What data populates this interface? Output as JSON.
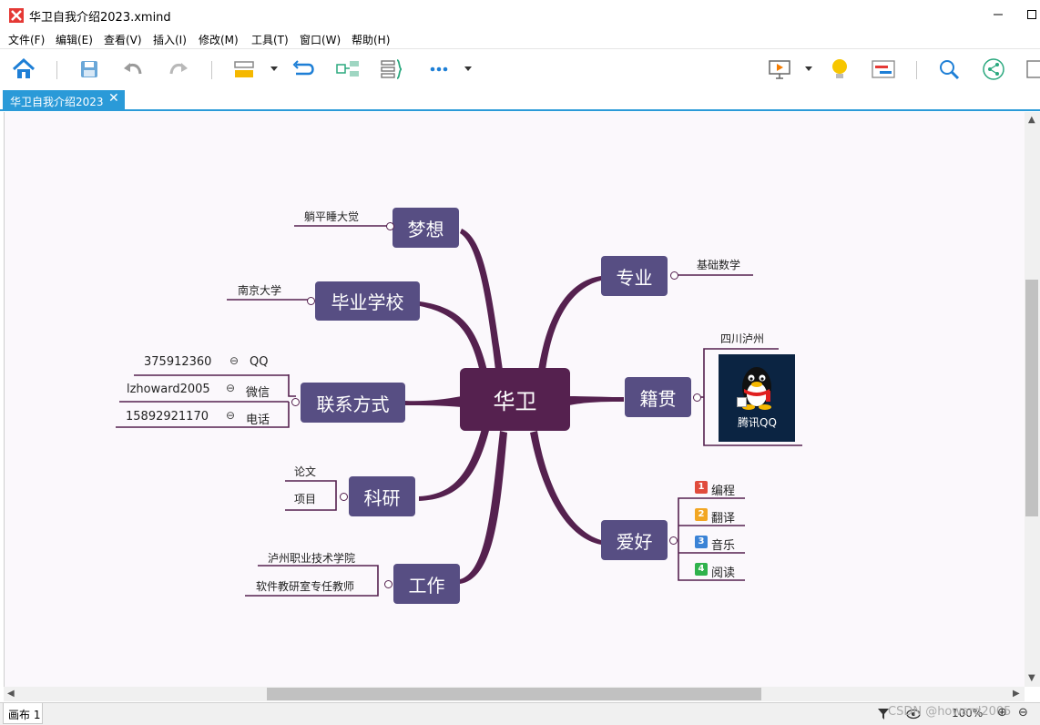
{
  "window": {
    "title": "华卫自我介绍2023.xmind",
    "minimize_glyph": "—",
    "maximize_glyph": "☐"
  },
  "menu": [
    "文件(F)",
    "编辑(E)",
    "查看(V)",
    "插入(I)",
    "修改(M)",
    "工具(T)",
    "窗口(W)",
    "帮助(H)"
  ],
  "toolbar": {
    "icons": [
      "home-icon",
      "save-icon",
      "undo-icon",
      "redo-icon",
      "topic-style-icon",
      "relationship-icon",
      "summary-icon",
      "boundary-icon",
      "more-icon",
      "presentation-icon",
      "idea-icon",
      "gantt-icon",
      "search-icon",
      "share-icon"
    ]
  },
  "tab": {
    "label": "华卫自我介绍2023",
    "close": "✕"
  },
  "mindmap": {
    "central": "华卫",
    "colors": {
      "central": "#55214f",
      "topic": "#574e83",
      "line": "#55214f",
      "canvas": "#fbf8fc"
    },
    "topics": {
      "dream": "梦想",
      "school": "毕业学校",
      "contact": "联系方式",
      "research": "科研",
      "work": "工作",
      "major": "专业",
      "hometown": "籍贯",
      "hobby": "爱好"
    },
    "subtopics": {
      "dream": [
        "躺平睡大觉"
      ],
      "school": [
        "南京大学"
      ],
      "contact": [
        {
          "value": "375912360",
          "label": "QQ"
        },
        {
          "value": "lzhoward2005",
          "label": "微信"
        },
        {
          "value": "15892921170",
          "label": "电话"
        }
      ],
      "research": [
        "论文",
        "项目"
      ],
      "work": [
        "泸州职业技术学院",
        "软件教研室专任教师"
      ],
      "major": [
        "基础数学"
      ],
      "hometown": [
        "四川泸州"
      ],
      "hobby": [
        {
          "num": "1",
          "label": "编程",
          "color": "#e04b3c"
        },
        {
          "num": "2",
          "label": "翻译",
          "color": "#f2a623"
        },
        {
          "num": "3",
          "label": "音乐",
          "color": "#3b83d6"
        },
        {
          "num": "4",
          "label": "阅读",
          "color": "#2fb24c"
        }
      ],
      "qq_image_caption": "腾讯QQ"
    }
  },
  "statusbar": {
    "sheet": "画布 1",
    "zoom": "100%",
    "watermark": "CSDN @howard2005"
  }
}
